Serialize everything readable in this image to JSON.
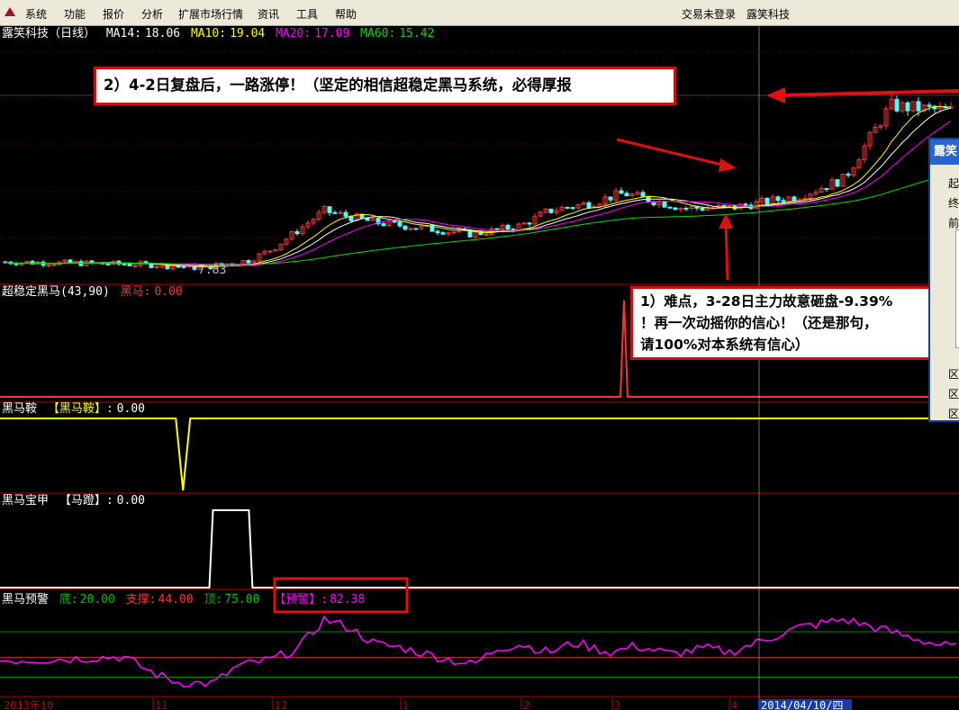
{
  "menu": {
    "items": [
      "系统",
      "功能",
      "报价",
      "分析",
      "扩展市场行情",
      "资讯",
      "工具",
      "帮助"
    ],
    "login_status": "交易未登录",
    "app_name": "露笑科技"
  },
  "colors": {
    "up": "#ff3232",
    "down": "#54fcfc",
    "ma14": "#ffffff",
    "ma10": "#ffff00",
    "ma20": "#ff00ff",
    "ma60": "#00e000",
    "divider": "#c00000"
  },
  "panels": {
    "main": {
      "title": "露笑科技（日线）",
      "ma14_label": "MA14:",
      "ma14_value": "18.06",
      "ma10_label": "MA10:",
      "ma10_value": "19.04",
      "ma20_label": "MA20:",
      "ma20_value": "17.09",
      "ma60_label": "MA60:",
      "ma60_value": "15.42",
      "low_mark": "7.83"
    },
    "heima": {
      "label": "超稳定黑马(43,90)",
      "sub_label": "黑马:",
      "sub_value": "0.00"
    },
    "saddle": {
      "label": "黑马鞍",
      "sub_label": "【黑马鞍】:",
      "sub_value": "0.00"
    },
    "armor": {
      "label": "黑马宝甲",
      "sub_label": "【马蹬】:",
      "sub_value": "0.00"
    },
    "warning": {
      "label": "黑马预警",
      "bottom_label": "底:",
      "bottom_value": "20.00",
      "support_label": "支撑:",
      "support_value": "44.00",
      "top_label": "顶:",
      "top_value": "75.00",
      "alert_label": "【预警】:",
      "alert_value": "82.38"
    }
  },
  "x_axis": {
    "ticks": [
      "2013年10",
      "11",
      "12",
      "1",
      "2",
      "3",
      "4"
    ],
    "cursor_date": "2014/04/10/四"
  },
  "annotations": {
    "note1_lines": [
      "1）难点，3-28日主力故意砸盘-9.39%",
      "！再一次动摇你的信心！（还是那句，",
      "请100%对本系统有信心）"
    ],
    "note2": "2）4-2日复盘后，一路涨停！（坚定的相信超稳定黑马系统，必得厚报"
  },
  "side_panel": {
    "title": "露笑",
    "labels": [
      "起",
      "终",
      "前",
      "区",
      "区",
      "区"
    ]
  },
  "chart_data": [
    {
      "type": "candlestick",
      "title": "露笑科技（日线）",
      "series": [
        {
          "name": "MA14",
          "last": 18.06
        },
        {
          "name": "MA10",
          "last": 19.04
        },
        {
          "name": "MA20",
          "last": 17.09
        },
        {
          "name": "MA60",
          "last": 15.42
        }
      ],
      "low_marked": 7.83,
      "price_trend": {
        "x_month_index": [
          0,
          0.6,
          1.0,
          1.4,
          1.8,
          2.0,
          2.4,
          2.8,
          3.2,
          3.6,
          4.0,
          4.3,
          4.8,
          5.1,
          5.6,
          6.0,
          6.3,
          6.5,
          6.7,
          7.0,
          7.3,
          7.6
        ],
        "close": [
          8.3,
          8.2,
          8.1,
          7.9,
          8.4,
          9.2,
          11.8,
          11.0,
          10.6,
          10.2,
          10.8,
          11.8,
          12.4,
          13.0,
          12.0,
          12.0,
          12.8,
          14.0,
          19.0,
          18.6,
          19.6,
          20.6
        ]
      }
    },
    {
      "type": "line",
      "title": "超稳定黑马(43,90)",
      "series": [
        {
          "name": "黑马",
          "last": 0.0,
          "spike_month_index": 5.1
        }
      ]
    },
    {
      "type": "line",
      "title": "黑马鞍",
      "series": [
        {
          "name": "【黑马鞍】",
          "last": 0.0,
          "spike_month_index": 1.25
        }
      ]
    },
    {
      "type": "line",
      "title": "黑马宝甲",
      "series": [
        {
          "name": "【马蹬】",
          "last": 0.0,
          "pulse_month_index": [
            1.5,
            1.8
          ]
        }
      ]
    },
    {
      "type": "line",
      "title": "黑马预警",
      "levels": {
        "底": 20.0,
        "支撑": 44.0,
        "顶": 75.0
      },
      "series": [
        {
          "name": "【预警】",
          "last": 82.38,
          "x_month_index": [
            0,
            0.4,
            0.8,
            1.0,
            1.2,
            1.5,
            1.7,
            2.0,
            2.2,
            2.4,
            2.6,
            2.8,
            3.0,
            3.3,
            3.6,
            3.8,
            4.0,
            4.3,
            4.6,
            4.8,
            5.0,
            5.2,
            5.5,
            5.8,
            6.0,
            6.3,
            6.5,
            6.7,
            6.9,
            7.1,
            7.4,
            7.6
          ],
          "values": [
            40,
            42,
            45,
            25,
            14,
            12,
            33,
            42,
            55,
            90,
            80,
            60,
            56,
            45,
            35,
            55,
            60,
            50,
            62,
            55,
            50,
            58,
            48,
            55,
            50,
            80,
            90,
            75,
            60,
            50,
            55,
            60
          ]
        }
      ]
    }
  ]
}
